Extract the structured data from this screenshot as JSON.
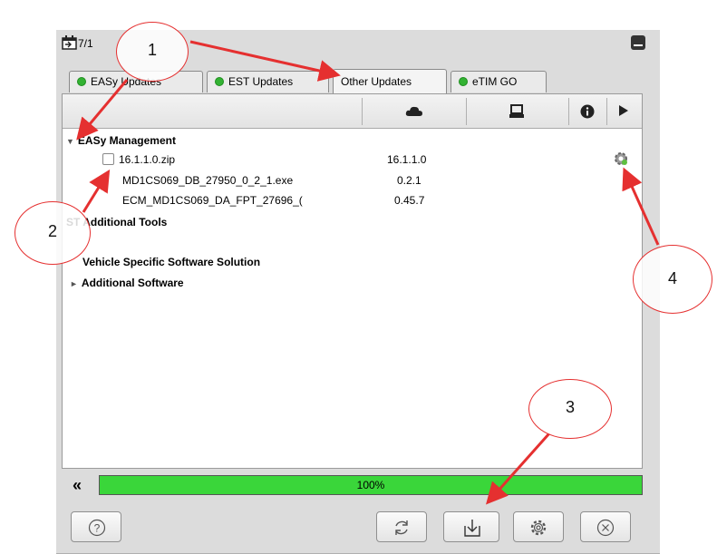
{
  "window": {
    "date_label": "7/1",
    "minimize_icon": "minimize-icon"
  },
  "tabs": [
    {
      "label": "EASy Updates",
      "status": "green",
      "active": false
    },
    {
      "label": "EST Updates",
      "status": "green",
      "active": false
    },
    {
      "label": "Other Updates",
      "status": "none",
      "active": true
    },
    {
      "label": "eTIM GO",
      "status": "green",
      "active": false
    }
  ],
  "columns": [
    "cloud-icon",
    "monitor-icon",
    "info-icon",
    "play-icon"
  ],
  "tree": [
    {
      "label": "EASy Management",
      "expanded": true,
      "version": ""
    },
    {
      "label": "16.1.1.0.zip",
      "version": "16.1.1.0",
      "checkbox": true
    },
    {
      "label": "MD1CS069_DB_27950_0_2_1.exe",
      "version": "0.2.1"
    },
    {
      "label": "ECM_MD1CS069_DA_FPT_27696_(",
      "version": "0.45.7"
    },
    {
      "label": "ST Additional Tools"
    },
    {
      "label": "Vehicle Specific Software Solution"
    },
    {
      "label": "Additional Software",
      "expanded": false
    }
  ],
  "progress": {
    "value": 1.0,
    "text": "100%",
    "color": "#3ad63a"
  },
  "collapse_label": "«",
  "buttons": [
    "help-button",
    "refresh-button",
    "download-button",
    "settings-button",
    "cancel-button"
  ],
  "callouts": [
    "1",
    "2",
    "3",
    "4"
  ],
  "annotation_color": "#e53030"
}
